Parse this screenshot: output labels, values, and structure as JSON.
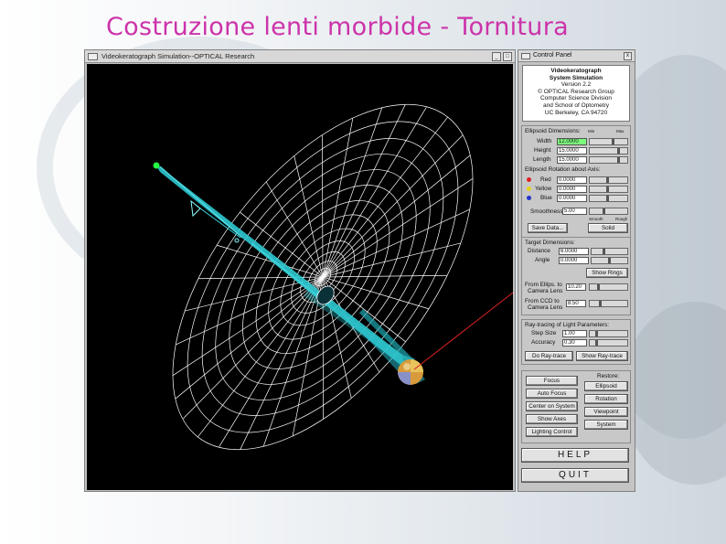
{
  "slide": {
    "title": "Costruzione lenti morbide - Tornitura"
  },
  "sim_window": {
    "title": "Videokeratograph Simulation--OPTICAL Research",
    "buttons": [
      "_",
      "□"
    ]
  },
  "control_panel": {
    "title": "Control Panel",
    "close": "x",
    "info": {
      "line1": "Videokeratograph",
      "line2": "System Simulation",
      "line3": "Version 2.2",
      "line4": "© OPTICAL Research Group",
      "line5": "Computer Science Division",
      "line6": "and School of Optometry",
      "line7": "UC Berkeley, CA 94720"
    },
    "ellipsoid_dims": {
      "header": "Ellipsoid Dimensions:",
      "min_label": "Min",
      "max_label": "Max",
      "rows": [
        {
          "label": "Width",
          "value": "12.0000"
        },
        {
          "label": "Height",
          "value": "15.0000"
        },
        {
          "label": "Length",
          "value": "15.0000"
        }
      ]
    },
    "rotation": {
      "header": "Ellipsoid Rotation about Axis:",
      "rows": [
        {
          "label": "Red",
          "value": "0.0000",
          "color": "#dd2222"
        },
        {
          "label": "Yellow",
          "value": "0.0000",
          "color": "#e6d21e"
        },
        {
          "label": "Blue",
          "value": "0.0000",
          "color": "#2233cc"
        }
      ]
    },
    "smoothness": {
      "label": "Smoothness",
      "value": "5.00",
      "smooth_label": "Smooth",
      "rough_label": "Rough"
    },
    "save_button": "Save Data...",
    "solid_button": "Solid",
    "target": {
      "header": "Target Dimensions:",
      "distance_label": "Distance",
      "distance_value": "6.0000",
      "angle_label": "Angle",
      "angle_value": "0.0000",
      "show_rings": "Show Rings",
      "ellips_label_1": "From Ellips. to",
      "ellips_label_2": "Camera Lens",
      "ellips_value": "10.20",
      "ccd_label_1": "From CCD to",
      "ccd_label_2": "Camera Lens",
      "ccd_value": "8.50"
    },
    "raytrace": {
      "header": "Ray-tracing of Light Parameters:",
      "step_label": "Step Size",
      "step_value": "1.00",
      "accuracy_label": "Accuracy",
      "accuracy_value": "0.30",
      "do_button": "Do Ray-trace",
      "show_button": "Show Ray-trace"
    },
    "bottom_left_buttons": [
      "Focus",
      "Auto Focus",
      "Center on System",
      "Show Axes",
      "Lighting Control"
    ],
    "restore": {
      "header": "Restore:",
      "buttons": [
        "Ellipsoid",
        "Rotation",
        "Viewpoint",
        "System"
      ]
    },
    "help": "HELP",
    "quit": "QUIT"
  },
  "colors": {
    "title_pink": "#cc33aa",
    "viewport_bg": "#000000",
    "mesh": "#ffffff",
    "beam": "#2ec8d0"
  }
}
